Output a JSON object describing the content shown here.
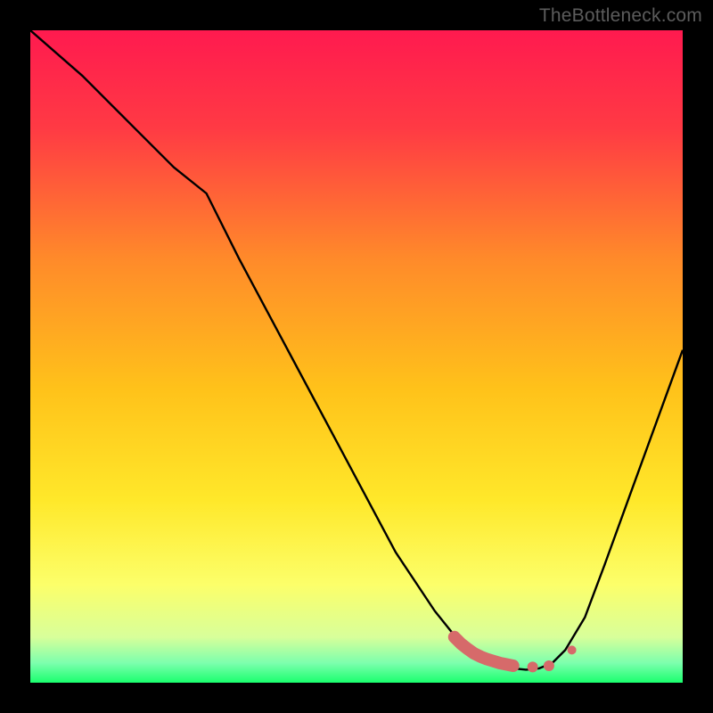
{
  "watermark": "TheBottleneck.com",
  "chart_data": {
    "type": "line",
    "title": "",
    "xlabel": "",
    "ylabel": "",
    "xlim": [
      0,
      100
    ],
    "ylim": [
      0,
      100
    ],
    "grid": false,
    "legend": false,
    "gradient_stops": [
      {
        "offset": 0,
        "color": "#ff1a4f"
      },
      {
        "offset": 0.15,
        "color": "#ff3a44"
      },
      {
        "offset": 0.35,
        "color": "#ff8a2a"
      },
      {
        "offset": 0.55,
        "color": "#ffc21a"
      },
      {
        "offset": 0.72,
        "color": "#ffe82a"
      },
      {
        "offset": 0.85,
        "color": "#fcff6a"
      },
      {
        "offset": 0.93,
        "color": "#d8ff9a"
      },
      {
        "offset": 0.97,
        "color": "#7cffad"
      },
      {
        "offset": 1.0,
        "color": "#1aff6e"
      }
    ],
    "series": [
      {
        "name": "bottleneck-curve",
        "stroke": "#000000",
        "stroke_width": 2.4,
        "x": [
          0,
          8,
          16,
          22,
          27,
          32,
          40,
          48,
          56,
          62,
          66,
          68,
          70,
          72,
          74,
          76,
          78,
          80,
          82,
          85,
          88,
          92,
          96,
          100
        ],
        "y": [
          100,
          93,
          85,
          79,
          75,
          65,
          50,
          35,
          20,
          11,
          6,
          4,
          3,
          2.5,
          2.2,
          2.0,
          2.2,
          3,
          5,
          10,
          18,
          29,
          40,
          51
        ]
      }
    ],
    "markers": [
      {
        "name": "highlight-segment",
        "shape": "round-line",
        "color": "#d66a6a",
        "width": 14,
        "x": [
          65,
          66,
          67,
          68,
          69,
          70,
          71,
          72,
          73,
          74
        ],
        "y": [
          7,
          6,
          5.2,
          4.5,
          4,
          3.6,
          3.3,
          3,
          2.8,
          2.6
        ]
      },
      {
        "name": "highlight-dot-1",
        "shape": "dot",
        "color": "#d66a6a",
        "r": 6,
        "x": 77,
        "y": 2.4
      },
      {
        "name": "highlight-dot-2",
        "shape": "dot",
        "color": "#d66a6a",
        "r": 6,
        "x": 79.5,
        "y": 2.6
      },
      {
        "name": "highlight-dot-3",
        "shape": "dot",
        "color": "#d66a6a",
        "r": 5,
        "x": 83,
        "y": 5
      }
    ]
  }
}
